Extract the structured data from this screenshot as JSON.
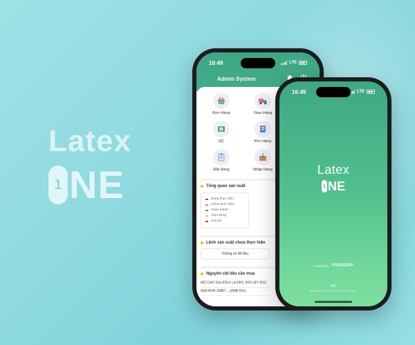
{
  "brand": {
    "word": "Latex",
    "one_badge": "1",
    "one_text": "NE"
  },
  "colors": {
    "primary_green": "#3ea883",
    "accent_yellow": "#f2b800",
    "background_teal": "#8dd9df"
  },
  "back_phone": {
    "status": {
      "time": "16:49",
      "network": "LTE"
    },
    "header": {
      "title": "Admin System",
      "icons": [
        "home-icon",
        "logout-icon"
      ]
    },
    "menu": [
      {
        "label": "Đơn Hàng",
        "icon": "shopping-basket-icon"
      },
      {
        "label": "Giao Hàng",
        "icon": "delivery-truck-icon"
      },
      {
        "label": "QC",
        "icon": "quality-check-icon"
      },
      {
        "label": "Kho Hàng",
        "icon": "warehouse-icon"
      },
      {
        "label": "Đặt Hàng",
        "icon": "order-clipboard-icon"
      },
      {
        "label": "Nhập Hàng",
        "icon": "import-goods-icon"
      }
    ],
    "production_overview": {
      "title": "Tổng quan sản xuất",
      "legend": [
        {
          "label": "Đang thực hiện",
          "color": "#3b5bdb"
        },
        {
          "label": "Chưa thực hiện",
          "color": "#ff7a45"
        },
        {
          "label": "Hoàn thành",
          "color": "#37b24d"
        },
        {
          "label": "Tạm dừng",
          "color": "#fcc419"
        },
        {
          "label": "Hủy bỏ",
          "color": "#e03131"
        }
      ]
    },
    "pending_orders": {
      "title": "Lệnh sản xuất chưa thực hiện",
      "empty_text": "Không có dữ liệu"
    },
    "materials": {
      "title": "Nguyên vật liệu cần mua",
      "items": [
        "MŨ CAO SULATEX LA DRC 60% (ET-001)",
        "ANCHOR ZMBT... (ZMB-001)"
      ]
    }
  },
  "front_phone": {
    "status": {
      "time": "16:49",
      "network": "LTE"
    },
    "logo": {
      "word": "Latex",
      "one_badge": "1",
      "one_text": "NE"
    },
    "created_by": "Created by",
    "company": "FOSO.ERP",
    "progress": {
      "label": "8%",
      "value": 0.08
    }
  }
}
